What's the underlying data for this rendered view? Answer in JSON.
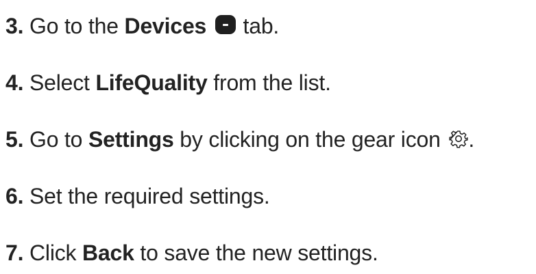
{
  "steps": [
    {
      "number": "3.",
      "before": "Go to the ",
      "bold": "Devices",
      "icon": "device-tab-icon",
      "after": " tab."
    },
    {
      "number": "4.",
      "before": "Select ",
      "bold": "LifeQuality",
      "after": " from the list."
    },
    {
      "number": "5.",
      "before": "Go to ",
      "bold": "Settings",
      "middle": " by clicking on the gear icon ",
      "icon": "gear-icon",
      "after": "."
    },
    {
      "number": "6.",
      "before": "Set the required settings."
    },
    {
      "number": "7.",
      "before": "Click ",
      "bold": "Back",
      "after": " to save the new settings."
    }
  ],
  "colors": {
    "text": "#222222",
    "icon_dark": "#1f1f1f",
    "background": "#ffffff"
  }
}
